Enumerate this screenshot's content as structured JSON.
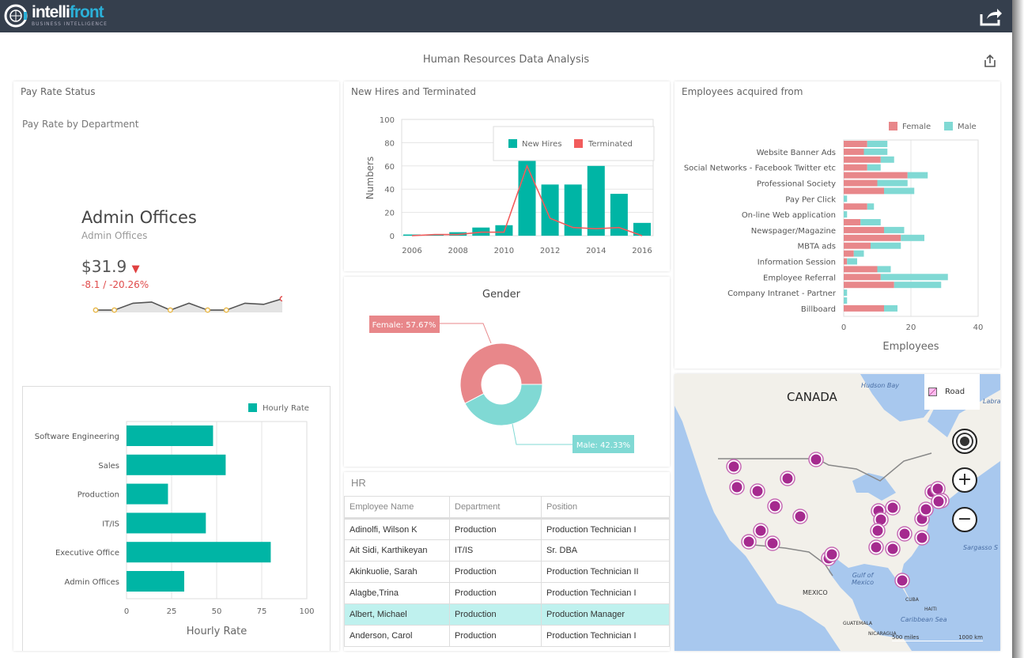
{
  "app": {
    "logo_main": "intelli",
    "logo_accent": "front",
    "logo_sub": "BUSINESS INTELLIGENCE"
  },
  "page": {
    "title": "Human Resources Data Analysis"
  },
  "colors": {
    "teal": "#00b5a5",
    "red": "#f25c5c",
    "female": "#e8878a",
    "male": "#80d9d4",
    "purple": "#a52a8e",
    "header": "#353f4d"
  },
  "pay_rate": {
    "panel_title": "Pay Rate Status",
    "subtitle": "Pay Rate by Department",
    "kpi": {
      "title": "Admin Offices",
      "subtitle": "Admin Offices",
      "value": "$31.9",
      "delta": "-8.1 / -20.26%",
      "trend": "down",
      "sparkline": [
        22,
        22,
        28,
        29,
        22,
        28,
        22,
        22,
        28,
        27,
        31.9
      ]
    },
    "chart": {
      "type": "bar",
      "orientation": "horizontal",
      "categories": [
        "Software Engineering",
        "Sales",
        "Production",
        "IT/IS",
        "Executive Office",
        "Admin Offices"
      ],
      "series": [
        {
          "name": "Hourly Rate",
          "values": [
            48,
            55,
            23,
            44,
            80,
            32
          ]
        }
      ],
      "xlabel": "Hourly Rate",
      "xlim": [
        0,
        100
      ],
      "ticks": [
        "0",
        "25",
        "50",
        "75",
        "100"
      ],
      "legend": "top-right",
      "grid": true
    }
  },
  "hires": {
    "panel_title": "New Hires and Terminated"
  },
  "gender": {
    "title": "Gender"
  },
  "sources": {
    "panel_title": "Employees acquired from"
  },
  "chart_data": [
    {
      "type": "bar",
      "x": [
        2006,
        2007,
        2008,
        2009,
        2010,
        2011,
        2012,
        2013,
        2014,
        2015,
        2016
      ],
      "series": [
        {
          "name": "New Hires",
          "type": "bar",
          "values": [
            1,
            1,
            3,
            7,
            9,
            65,
            44,
            44,
            60,
            36,
            11
          ]
        },
        {
          "name": "Terminated",
          "type": "line",
          "values": [
            0,
            1,
            1,
            3,
            3,
            60,
            15,
            7,
            6,
            7,
            0
          ]
        }
      ],
      "ylabel": "Numbers",
      "ylim": [
        0,
        100
      ],
      "yticks": [
        "0",
        "20",
        "40",
        "60",
        "80",
        "100"
      ],
      "xticks": [
        "2006",
        "2008",
        "2010",
        "2012",
        "2014",
        "2016"
      ],
      "legend": "top-right",
      "grid": true
    },
    {
      "type": "pie",
      "title": "Gender",
      "donut": true,
      "slices": [
        {
          "label": "Female: 57.67%",
          "name": "Female",
          "value": 57.67
        },
        {
          "label": "Male: 42.33%",
          "name": "Male",
          "value": 42.33
        }
      ]
    },
    {
      "type": "bar",
      "orientation": "horizontal",
      "stacked": true,
      "categories": [
        "",
        "Website Banner Ads",
        "",
        "Social Networks - Facebook Twitter etc",
        "",
        "Professional Society",
        "",
        "Pay Per Click",
        "",
        "On-line Web application",
        "",
        "Newspager/Magazine",
        "",
        "MBTA ads",
        "",
        "Information Session",
        "",
        "Employee Referral",
        "",
        "Company Intranet - Partner",
        "",
        "Billboard"
      ],
      "series": [
        {
          "name": "Female",
          "values": [
            7,
            6,
            11,
            7,
            19,
            10,
            12,
            0,
            7,
            0,
            5,
            12,
            17,
            8,
            3,
            1,
            10,
            11,
            15,
            0,
            0,
            12
          ]
        },
        {
          "name": "Male",
          "values": [
            6,
            7,
            4,
            4,
            6,
            9,
            9,
            1,
            2,
            1,
            6,
            6,
            7,
            9,
            3,
            3,
            4,
            20,
            14,
            1,
            1,
            4
          ]
        }
      ],
      "xlabel": "Employees",
      "xlim": [
        0,
        40
      ],
      "xticks": [
        "0",
        "20",
        "40"
      ],
      "legend": "top-right",
      "grid": true
    }
  ],
  "hr": {
    "panel_title": "HR",
    "columns": [
      "Employee Name",
      "Department",
      "Position"
    ],
    "rows": [
      [
        "Adinolfi, Wilson K",
        "Production",
        "Production Technician I"
      ],
      [
        "Ait Sidi, Karthikeyan",
        "IT/IS",
        "Sr. DBA"
      ],
      [
        "Akinkuolie, Sarah",
        "Production",
        "Production Technician II"
      ],
      [
        "Alagbe,Trina",
        "Production",
        "Production Technician I"
      ],
      [
        "Albert, Michael",
        "Production",
        "Production Manager"
      ],
      [
        "Anderson, Carol",
        "Production",
        "Production Technician I"
      ]
    ],
    "selected_row": 4
  },
  "map": {
    "style_label": "Road",
    "labels": {
      "canada": "CANADA",
      "hudson": "Hudson Bay",
      "labrador": "Labra",
      "sargasso": "Sargasso S",
      "gulf": "Gulf of Mexico",
      "mexico": "MEXICO",
      "cuba": "CUBA",
      "haiti": "HAITI",
      "caribbean": "Caribbean Sea",
      "guatemala": "GUATEMALA",
      "nicaragua": "NICARAGUA",
      "scale_mi": "500 miles",
      "scale_km": "1000 km"
    }
  }
}
